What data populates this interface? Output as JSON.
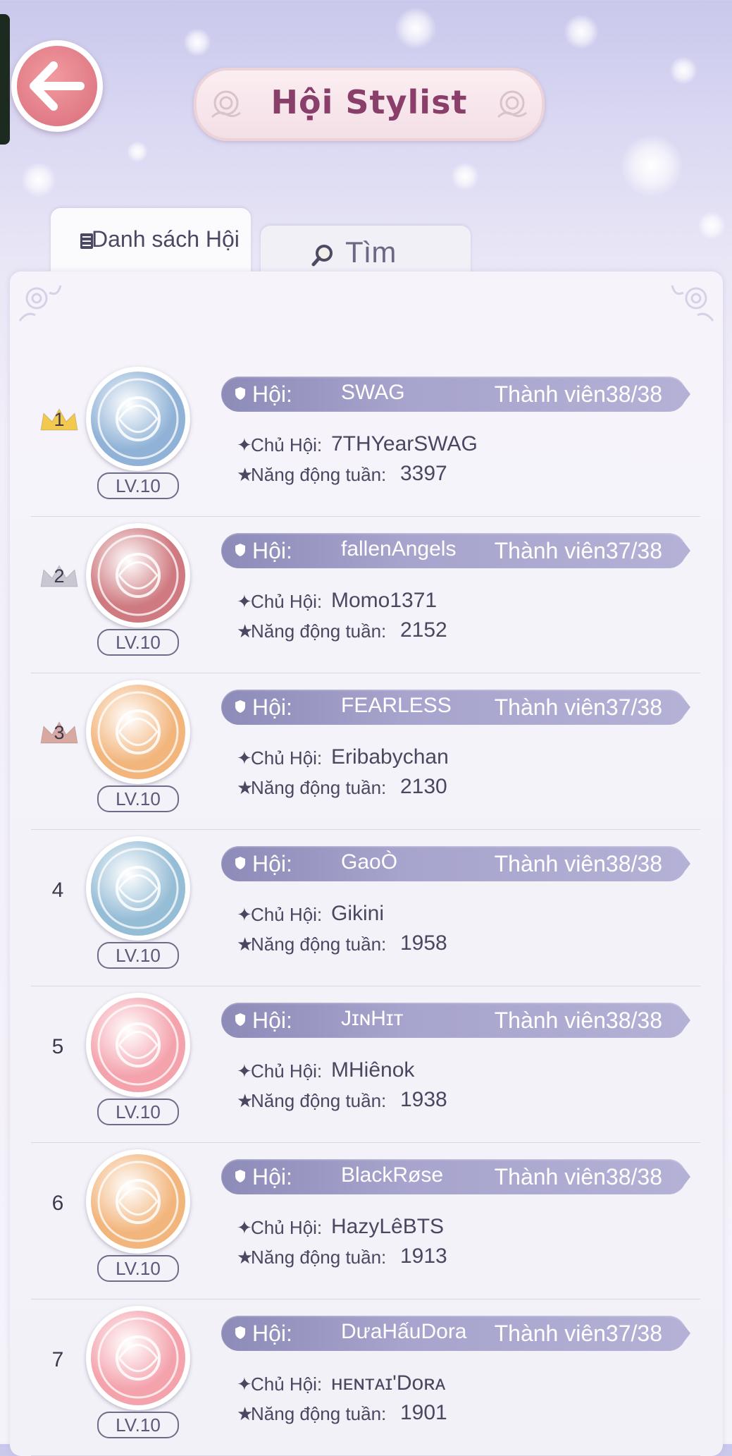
{
  "header": {
    "back_icon": "back-arrow-icon",
    "title": "Hội Stylist"
  },
  "tabs": [
    {
      "label": "Danh sách Hội",
      "icon": "list-icon",
      "active": true
    },
    {
      "label": "Tìm",
      "icon": "magnifier-icon",
      "active": false
    }
  ],
  "labels": {
    "guild": "Hội:",
    "owner": "Chủ Hội:",
    "activity": "Năng động tuần:",
    "members_prefix": "Thành viên"
  },
  "colors": {
    "accent_purple": "#9e9bc6",
    "title_color": "#8a3f6a",
    "back_button": "#e07b86"
  },
  "guilds": [
    {
      "rank": "1",
      "crown": "gold",
      "name": "SWAG",
      "owner": "7THYearSWAG",
      "activity": "3397",
      "members": "Thành viên38/38",
      "level": "LV.10",
      "emblem_color": "#8fb2d6"
    },
    {
      "rank": "2",
      "crown": "silver",
      "name": "fallenAngels",
      "owner": "Momo1371",
      "activity": "2152",
      "members": "Thành viên37/38",
      "level": "LV.10",
      "emblem_color": "#cf7a80"
    },
    {
      "rank": "3",
      "crown": "bronze",
      "name": "FEARLESS",
      "owner": "Eribabychan",
      "activity": "2130",
      "members": "Thành viên37/38",
      "level": "LV.10",
      "emblem_color": "#f2b57c"
    },
    {
      "rank": "4",
      "crown": "",
      "name": "GaoÒ",
      "owner": "Gikini",
      "activity": "1958",
      "members": "Thành viên38/38",
      "level": "LV.10",
      "emblem_color": "#96bdd6"
    },
    {
      "rank": "5",
      "crown": "",
      "name": "JɪɴHɪᴛ",
      "owner": "MHiênok",
      "activity": "1938",
      "members": "Thành viên38/38",
      "level": "LV.10",
      "emblem_color": "#f4a3ad"
    },
    {
      "rank": "6",
      "crown": "",
      "name": "BlackRøse",
      "owner": "HazyLêBTS",
      "activity": "1913",
      "members": "Thành viên38/38",
      "level": "LV.10",
      "emblem_color": "#f2b57c"
    },
    {
      "rank": "7",
      "crown": "",
      "name": "DưaHấuDora",
      "owner": "ʜᴇɴᴛᴀɪ'Dᴏʀᴀ",
      "activity": "1901",
      "members": "Thành viên37/38",
      "level": "LV.10",
      "emblem_color": "#f4a3ad"
    }
  ]
}
